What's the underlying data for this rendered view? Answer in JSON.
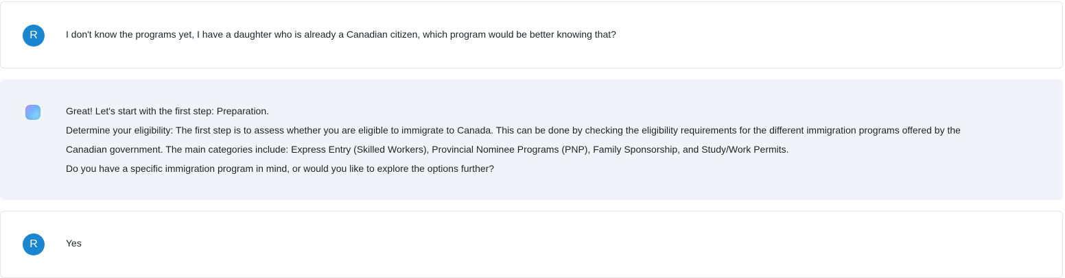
{
  "messages": [
    {
      "role": "user",
      "avatar_letter": "R",
      "lines": [
        "I don't know the programs yet, I have a daughter who is already a Canadian citizen, which program would be better knowing that?"
      ]
    },
    {
      "role": "assistant",
      "avatar_icon": "assistant-logo-icon",
      "lines": [
        "Great! Let's start with the first step: Preparation.",
        "Determine your eligibility: The first step is to assess whether you are eligible to immigrate to Canada. This can be done by checking the eligibility requirements for the different immigration programs offered by the",
        "Canadian government. The main categories include: Express Entry (Skilled Workers), Provincial Nominee Programs (PNP), Family Sponsorship, and Study/Work Permits.",
        "Do you have a specific immigration program in mind, or would you like to explore the options further?"
      ]
    },
    {
      "role": "user",
      "avatar_letter": "R",
      "lines": [
        "Yes"
      ]
    }
  ],
  "colors": {
    "user_avatar_bg": "#1a86d0",
    "assistant_bubble_bg": "#f0f3f7",
    "user_bubble_border": "#e3e6ea",
    "text": "#1f2328"
  }
}
